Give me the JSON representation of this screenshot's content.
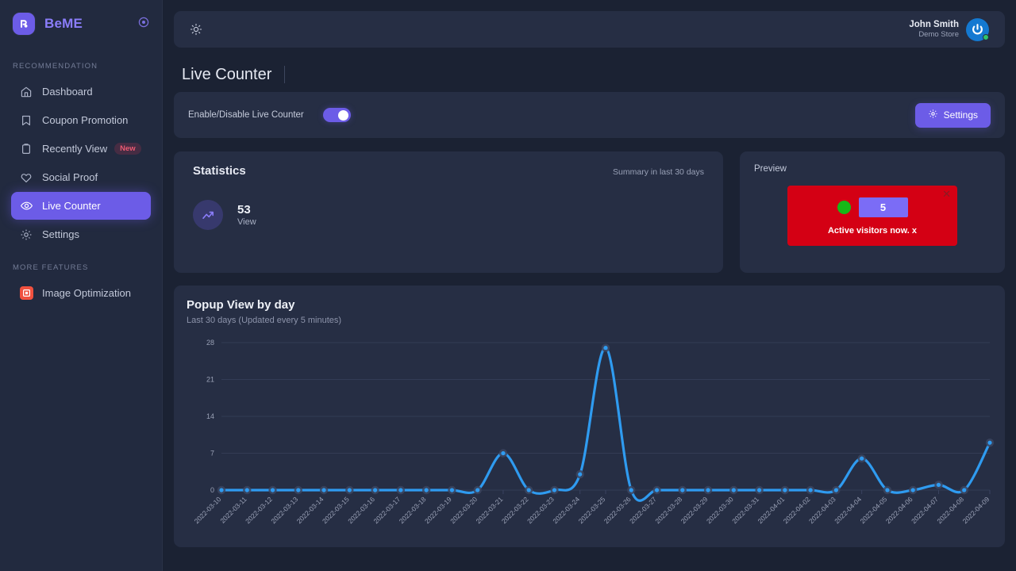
{
  "brand": {
    "name": "BeME",
    "logo_icon": "beme-logo-icon",
    "collapse_icon": "collapse-circle-icon"
  },
  "sidebar": {
    "sections": [
      {
        "label": "RECOMMENDATION",
        "items": [
          {
            "label": "Dashboard",
            "icon": "home-icon",
            "active": false
          },
          {
            "label": "Coupon Promotion",
            "icon": "bookmark-icon",
            "active": false
          },
          {
            "label": "Recently View",
            "icon": "clipboard-icon",
            "active": false,
            "badge": "New"
          },
          {
            "label": "Social Proof",
            "icon": "heart-icon",
            "active": false
          },
          {
            "label": "Live Counter",
            "icon": "eye-icon",
            "active": true
          },
          {
            "label": "Settings",
            "icon": "gear-icon",
            "active": false
          }
        ]
      },
      {
        "label": "MORE FEATURES",
        "items": [
          {
            "label": "Image Optimization",
            "icon": "image-optimization-icon",
            "active": false
          }
        ]
      }
    ]
  },
  "topbar": {
    "theme_icon": "sun-icon",
    "user_name": "John Smith",
    "user_store": "Demo Store",
    "avatar_icon": "power-avatar-icon",
    "status": "online"
  },
  "page": {
    "title": "Live Counter"
  },
  "toggle_bar": {
    "label": "Enable/Disable Live Counter",
    "enabled": true,
    "settings_label": "Settings",
    "settings_icon": "gear-icon"
  },
  "statistics": {
    "title": "Statistics",
    "summary": "Summary in last 30 days",
    "metric_icon": "trending-up-icon",
    "value": "53",
    "label": "View"
  },
  "preview": {
    "title": "Preview",
    "popup": {
      "count": "5",
      "text": "Active visitors now. x",
      "close_icon": "close-icon",
      "dot_color": "#17b917",
      "bg_color": "#d40014",
      "count_bg_color": "#7b6cf6"
    }
  },
  "colors": {
    "accent": "#6c5ce7",
    "sidebar_bg": "#222a3f",
    "card_bg": "#262e44",
    "page_bg": "#1b2233",
    "chart_line": "#2f9bf0",
    "badge_new": "#ec5a72"
  },
  "chart_data": {
    "type": "line",
    "title": "Popup View by day",
    "subtitle": "Last 30 days (Updated every 5 minutes)",
    "xlabel": "",
    "ylabel": "",
    "ylim": [
      0,
      28
    ],
    "yticks": [
      0,
      7,
      14,
      21,
      28
    ],
    "grid": true,
    "legend": "none",
    "line_color": "#2f9bf0",
    "categories": [
      "2022-03-10",
      "2022-03-11",
      "2022-03-12",
      "2022-03-13",
      "2022-03-14",
      "2022-03-15",
      "2022-03-16",
      "2022-03-17",
      "2022-03-18",
      "2022-03-19",
      "2022-03-20",
      "2022-03-21",
      "2022-03-22",
      "2022-03-23",
      "2022-03-24",
      "2022-03-25",
      "2022-03-26",
      "2022-03-27",
      "2022-03-28",
      "2022-03-29",
      "2022-03-30",
      "2022-03-31",
      "2022-04-01",
      "2022-04-02",
      "2022-04-03",
      "2022-04-04",
      "2022-04-05",
      "2022-04-06",
      "2022-04-07",
      "2022-04-08",
      "2022-04-09"
    ],
    "values": [
      0,
      0,
      0,
      0,
      0,
      0,
      0,
      0,
      0,
      0,
      0,
      7,
      0,
      0,
      3,
      27,
      0,
      0,
      0,
      0,
      0,
      0,
      0,
      0,
      0,
      6,
      0,
      0,
      1,
      0,
      9
    ]
  }
}
